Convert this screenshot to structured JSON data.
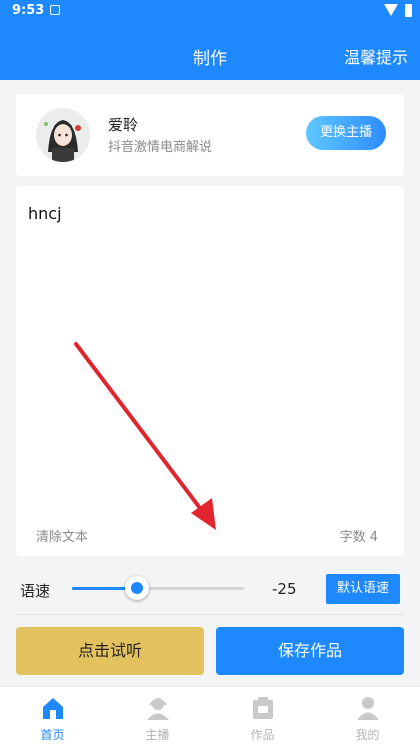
{
  "status_bar": {
    "time": "9:53"
  },
  "nav": {
    "title": "制作",
    "tips": "温馨提示"
  },
  "host": {
    "name": "爱聆",
    "desc": "抖音激情电商解说",
    "change_label": "更换主播"
  },
  "editor": {
    "text": "hncj",
    "clear_label": "清除文本",
    "char_count": "字数 4"
  },
  "speed": {
    "label": "语速",
    "value": "-25",
    "default_label": "默认语速",
    "level_fraction": 0.375
  },
  "actions": {
    "listen": "点击试听",
    "save": "保存作品"
  },
  "tabs": [
    {
      "label": "首页",
      "icon": "home-icon",
      "active": true
    },
    {
      "label": "主播",
      "icon": "anchor-icon",
      "active": false
    },
    {
      "label": "作品",
      "icon": "works-icon",
      "active": false
    },
    {
      "label": "我的",
      "icon": "profile-icon",
      "active": false
    }
  ],
  "colors": {
    "primary": "#1e88ff",
    "listen": "#e3c25f",
    "arrow": "#e0252e"
  }
}
